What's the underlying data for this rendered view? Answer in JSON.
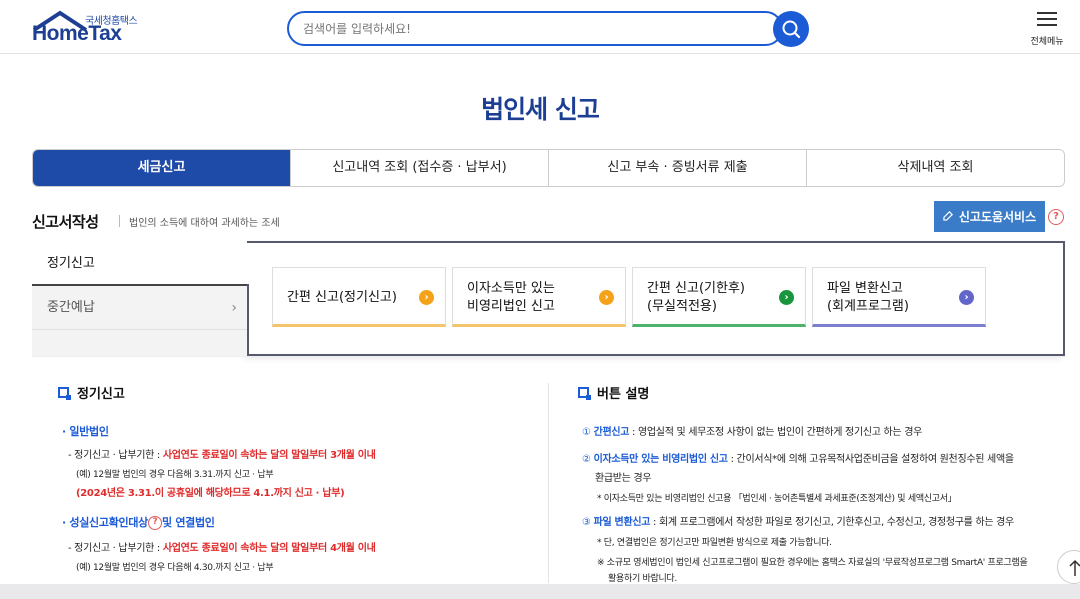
{
  "header": {
    "logo_ko": "국세청홈택스",
    "logo_en": "HomeTax",
    "search_placeholder": "검색어를 입력하세요!",
    "menu_label": "전체메뉴"
  },
  "page": {
    "title": "법인세 신고"
  },
  "tabs": [
    {
      "label": "세금신고",
      "active": true
    },
    {
      "label": "신고내역 조회 (접수증 · 납부서)",
      "active": false
    },
    {
      "label": "신고 부속 · 증빙서류 제출",
      "active": false
    },
    {
      "label": "삭제내역 조회",
      "active": false
    }
  ],
  "section": {
    "title": "신고서작성",
    "desc": "법인의 소득에 대하여 과세하는 조세",
    "help_button": "신고도움서비스",
    "help_q": "?"
  },
  "side": {
    "regular": "정기신고",
    "interim": "중간예납",
    "chevron": "›"
  },
  "cards": [
    {
      "line1": "간편 신고(정기신고)",
      "line2": "",
      "dot": "›"
    },
    {
      "line1": "이자소득만 있는",
      "line2": "비영리법인 신고",
      "dot": "›"
    },
    {
      "line1": "간편 신고(기한후)",
      "line2": "(무실적전용)",
      "dot": "›"
    },
    {
      "line1": "파일 변환신고",
      "line2": "(회계프로그램)",
      "dot": "›"
    }
  ],
  "left": {
    "title": "정기신고",
    "general": "· 일반법인",
    "g_label": "- 정기신고 · 납부기한 : ",
    "g_red": "사업연도 종료일이 속하는 달의 말일부터 3개월 이내",
    "g_ex": "(예) 12월말 법인의 경우 다음해 3.31.까지 신고 · 납부",
    "g_note": "(2024년은 3.31.이 공휴일에 해당하므로 4.1.까지 신고 · 납부)",
    "faith": "· 성실신고확인대상",
    "faith_q": "?",
    "faith_tail": "및 연결법인",
    "f_label": "- 정기신고 · 납부기한 : ",
    "f_red": "사업연도 종료일이 속하는 달의 말일부터 4개월 이내",
    "f_ex": "(예) 12월말 법인의 경우 다음해 4.30.까지 신고 · 납부"
  },
  "right": {
    "title": "버튼 설명",
    "n1": "①",
    "i1_name": "간편신고",
    "i1_text": " : 영업실적 및 세무조정 사항이 없는 법인이 간편하게 정기신고 하는 경우",
    "n2": "②",
    "i2_name": "이자소득만 있는 비영리법인 신고",
    "i2_text": " : 간이서식*에 의해 고유목적사업준비금을 설정하여 원천징수된 세액을",
    "i2_text2": "환급받는 경우",
    "i2_note": "* 이자소득만 있는 비영리법인 신고용 「법인세 · 농어촌특별세 과세표준(조정계산) 및 세액신고서」",
    "n3": "③",
    "i3_name": "파일 변환신고",
    "i3_text": " : 회계 프로그램에서 작성한 파일로 정기신고, 기한후신고, 수정신고, 경정청구를 하는 경우",
    "i3_note1": "* 단, 연결법인은 정기신고만 파일변환 방식으로 제출 가능합니다.",
    "i3_note2": "※ 소규모 영세법인이 법인세 신고프로그램이 필요한 경우에는 홈택스 자료실의 '무료작성프로그램 SmartA' 프로그램을",
    "i3_note3": "활용하기 바랍니다."
  },
  "colors": {
    "brand_blue": "#1e4aa8",
    "accent": "#1c5bd6",
    "red": "#e02b2b"
  }
}
